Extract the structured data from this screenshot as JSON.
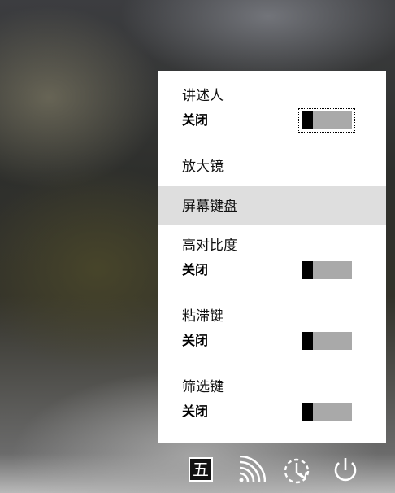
{
  "accessibility_menu": {
    "items": [
      {
        "title": "讲述人",
        "state": "关闭",
        "has_toggle": true,
        "focused": true
      },
      {
        "title": "放大镜",
        "has_toggle": false
      },
      {
        "title": "屏幕键盘",
        "has_toggle": false,
        "highlighted": true
      },
      {
        "title": "高对比度",
        "state": "关闭",
        "has_toggle": true
      },
      {
        "title": "粘滞键",
        "state": "关闭",
        "has_toggle": true
      },
      {
        "title": "筛选键",
        "state": "关闭",
        "has_toggle": true
      }
    ]
  },
  "taskbar": {
    "ime_label": "五",
    "icons": [
      "ime-wubi-icon",
      "wireless-signal-icon",
      "ease-of-access-icon",
      "power-icon"
    ]
  },
  "colors": {
    "panel_bg": "#ffffff",
    "highlight_bg": "#dedede",
    "toggle_track": "#a9a9a9",
    "toggle_thumb": "#000000"
  }
}
